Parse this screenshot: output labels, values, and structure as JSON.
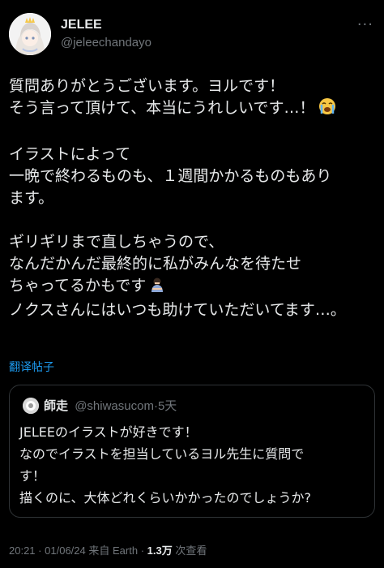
{
  "author": {
    "name": "JELEE",
    "handle": "@jeleechandayo"
  },
  "post": {
    "paragraphs": [
      [
        "質問ありがとうございます。ヨルです！",
        "そう言って頂けて、本当にうれしいです…！"
      ],
      [
        "イラストによって",
        "一晩で終わるものも、１週間かかるものもあり",
        "ます。"
      ],
      [
        "ギリギリまで直しちゃうので、",
        "なんだかんだ最終的に私がみんなを待たせ",
        "ちゃってるかもです",
        "ノクスさんにはいつも助けていただいてます…。"
      ]
    ],
    "emojis": [
      "loudly-crying-face",
      "person-bowing"
    ]
  },
  "translate_label": "翻译帖子",
  "quote": {
    "author_name": "師走",
    "author_handle": "@shiwasucom",
    "separator": "·",
    "time": "5天",
    "lines": [
      "JELEEのイラストが好きです！",
      "なのでイラストを担当しているヨル先生に質問で",
      "す！",
      "描くのに、大体どれくらいかかったのでしょうか?"
    ]
  },
  "meta": {
    "time": "20:21",
    "date": "01/06/24",
    "source": "来自 Earth",
    "views_count": "1.3万",
    "views_label": "次查看",
    "separator": "·"
  },
  "colors": {
    "background": "#000000",
    "text": "#e7e9ea",
    "muted": "#71767b",
    "link": "#1d9bf0",
    "border": "#2f3336"
  }
}
